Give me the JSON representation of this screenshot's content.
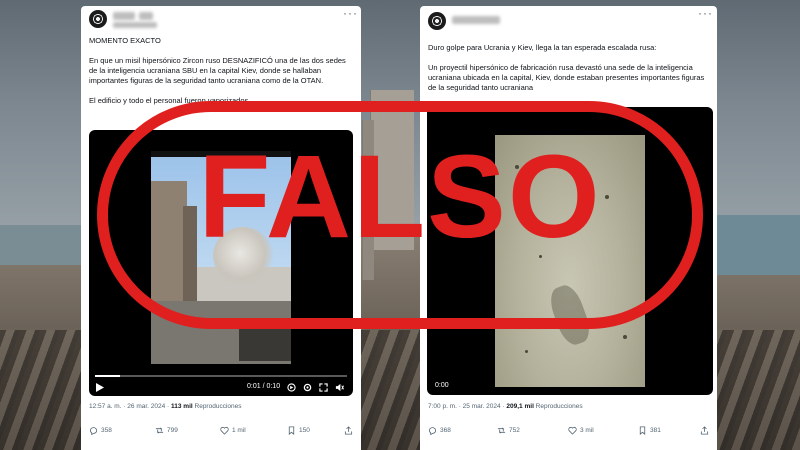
{
  "stamp": {
    "label": "FALSO",
    "color": "#e0201f"
  },
  "left_post": {
    "more_label": "···",
    "paragraphs": [
      "MOMENTO EXACTO",
      "En que un misil hipersónico Zircon ruso DESNAZIFICÓ una de las dos sedes de la inteligencia ucraniana SBU en la capital Kiev, donde se hallaban importantes figuras de la seguridad tanto ucraniana como de la OTAN.",
      "El edificio y todo el personal fueron vaporizados."
    ],
    "video": {
      "time": "0:01 / 0:10",
      "progress": 0.1
    },
    "meta": {
      "time": "12:57 a. m. · 26 mar. 2024 · ",
      "views": "113 mil",
      "views_label": " Reproducciones"
    },
    "actions": {
      "replies": "358",
      "reposts": "799",
      "likes": "1 mil",
      "bookmarks": "150"
    }
  },
  "right_post": {
    "more_label": "···",
    "paragraphs": [
      "Duro golpe para Ucrania y Kiev, llega la tan esperada escalada rusa:",
      "Un proyectil hipersónico de fabricación rusa devastó una sede de la inteligencia ucraniana ubicada en la capital, Kiev, donde estaban presentes importantes figuras de la seguridad tanto ucraniana"
    ],
    "video": {
      "time": "0:00"
    },
    "meta": {
      "time": "7:00 p. m. · 25 mar. 2024 · ",
      "views": "209,1 mil",
      "views_label": " Reproducciones"
    },
    "actions": {
      "replies": "368",
      "reposts": "752",
      "likes": "3 mil",
      "bookmarks": "381"
    }
  },
  "icons": [
    "reply-icon",
    "repost-icon",
    "like-icon",
    "bookmark-icon",
    "share-icon",
    "play-icon",
    "settings-icon",
    "fullscreen-icon",
    "volume-icon"
  ]
}
